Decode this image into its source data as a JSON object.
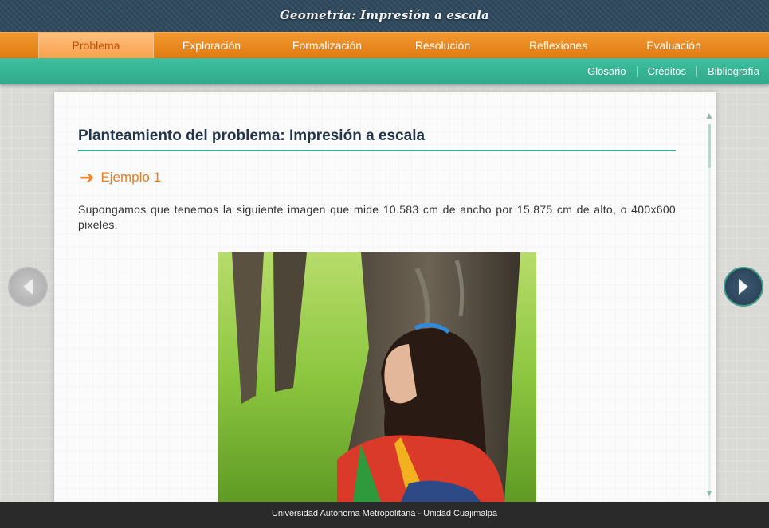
{
  "header": {
    "title": "Geometría: Impresión a escala"
  },
  "main_nav": {
    "tabs": [
      {
        "label": "Problema",
        "active": true
      },
      {
        "label": "Exploración",
        "active": false
      },
      {
        "label": "Formalización",
        "active": false
      },
      {
        "label": "Resolución",
        "active": false
      },
      {
        "label": "Reflexiones",
        "active": false
      },
      {
        "label": "Evaluación",
        "active": false
      }
    ]
  },
  "sub_nav": {
    "links": [
      "Glosario",
      "Créditos",
      "Bibliografía"
    ]
  },
  "content": {
    "heading": "Planteamiento del problema: Impresión a escala",
    "example_label": "Ejemplo 1",
    "paragraph": "Supongamos que tenemos la siguiente imagen que mide 10.583 cm de ancho por 15.875 cm de alto, o 400x600 pixeles."
  },
  "icons": {
    "example_arrow": "arrow-right-icon",
    "prev": "chevron-left-icon",
    "next": "chevron-right-icon",
    "scroll_up": "arrow-up-icon",
    "scroll_down": "arrow-down-icon"
  },
  "colors": {
    "orange_nav": "#e88520",
    "teal_subnav": "#36b393",
    "header_dark": "#2f4a5e",
    "heading_text": "#24344a"
  },
  "footer": {
    "text": "Universidad Autónoma Metropolitana - Unidad Cuajimalpa"
  }
}
